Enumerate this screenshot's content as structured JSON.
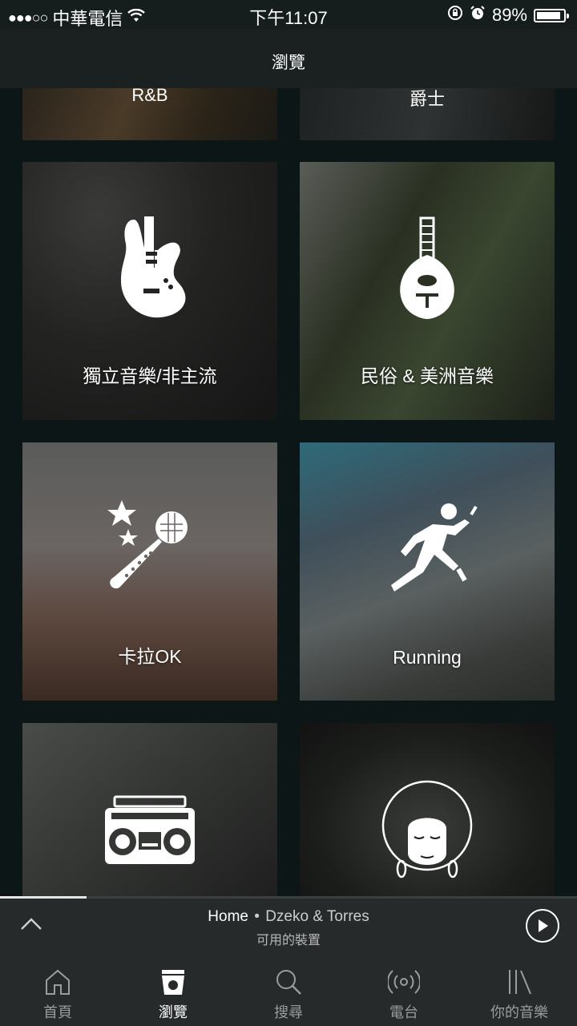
{
  "status_bar": {
    "signal": "●●●○○",
    "carrier": "中華電信",
    "time": "下午11:07",
    "battery": "89%"
  },
  "header": {
    "title": "瀏覽"
  },
  "top_tiles": [
    {
      "label": "R&B"
    },
    {
      "label": "爵士"
    }
  ],
  "tiles": [
    {
      "label": "獨立音樂/非主流",
      "icon": "electric-guitar-icon"
    },
    {
      "label": "民俗 & 美洲音樂",
      "icon": "mandolin-icon"
    },
    {
      "label": "卡拉OK",
      "icon": "karaoke-microphone-icon"
    },
    {
      "label": "Running",
      "icon": "running-figure-icon"
    },
    {
      "label": "",
      "icon": "boombox-icon"
    },
    {
      "label": "",
      "icon": "afro-face-icon"
    }
  ],
  "player": {
    "title": "Home",
    "separator": "•",
    "artist": "Dzeko & Torres",
    "subtitle": "可用的裝置",
    "progress": 0.15
  },
  "tab_bar": {
    "items": [
      {
        "label": "首頁",
        "icon": "home-icon"
      },
      {
        "label": "瀏覽",
        "icon": "browse-icon",
        "active": true
      },
      {
        "label": "搜尋",
        "icon": "search-icon"
      },
      {
        "label": "電台",
        "icon": "radio-icon"
      },
      {
        "label": "你的音樂",
        "icon": "library-icon"
      }
    ]
  }
}
